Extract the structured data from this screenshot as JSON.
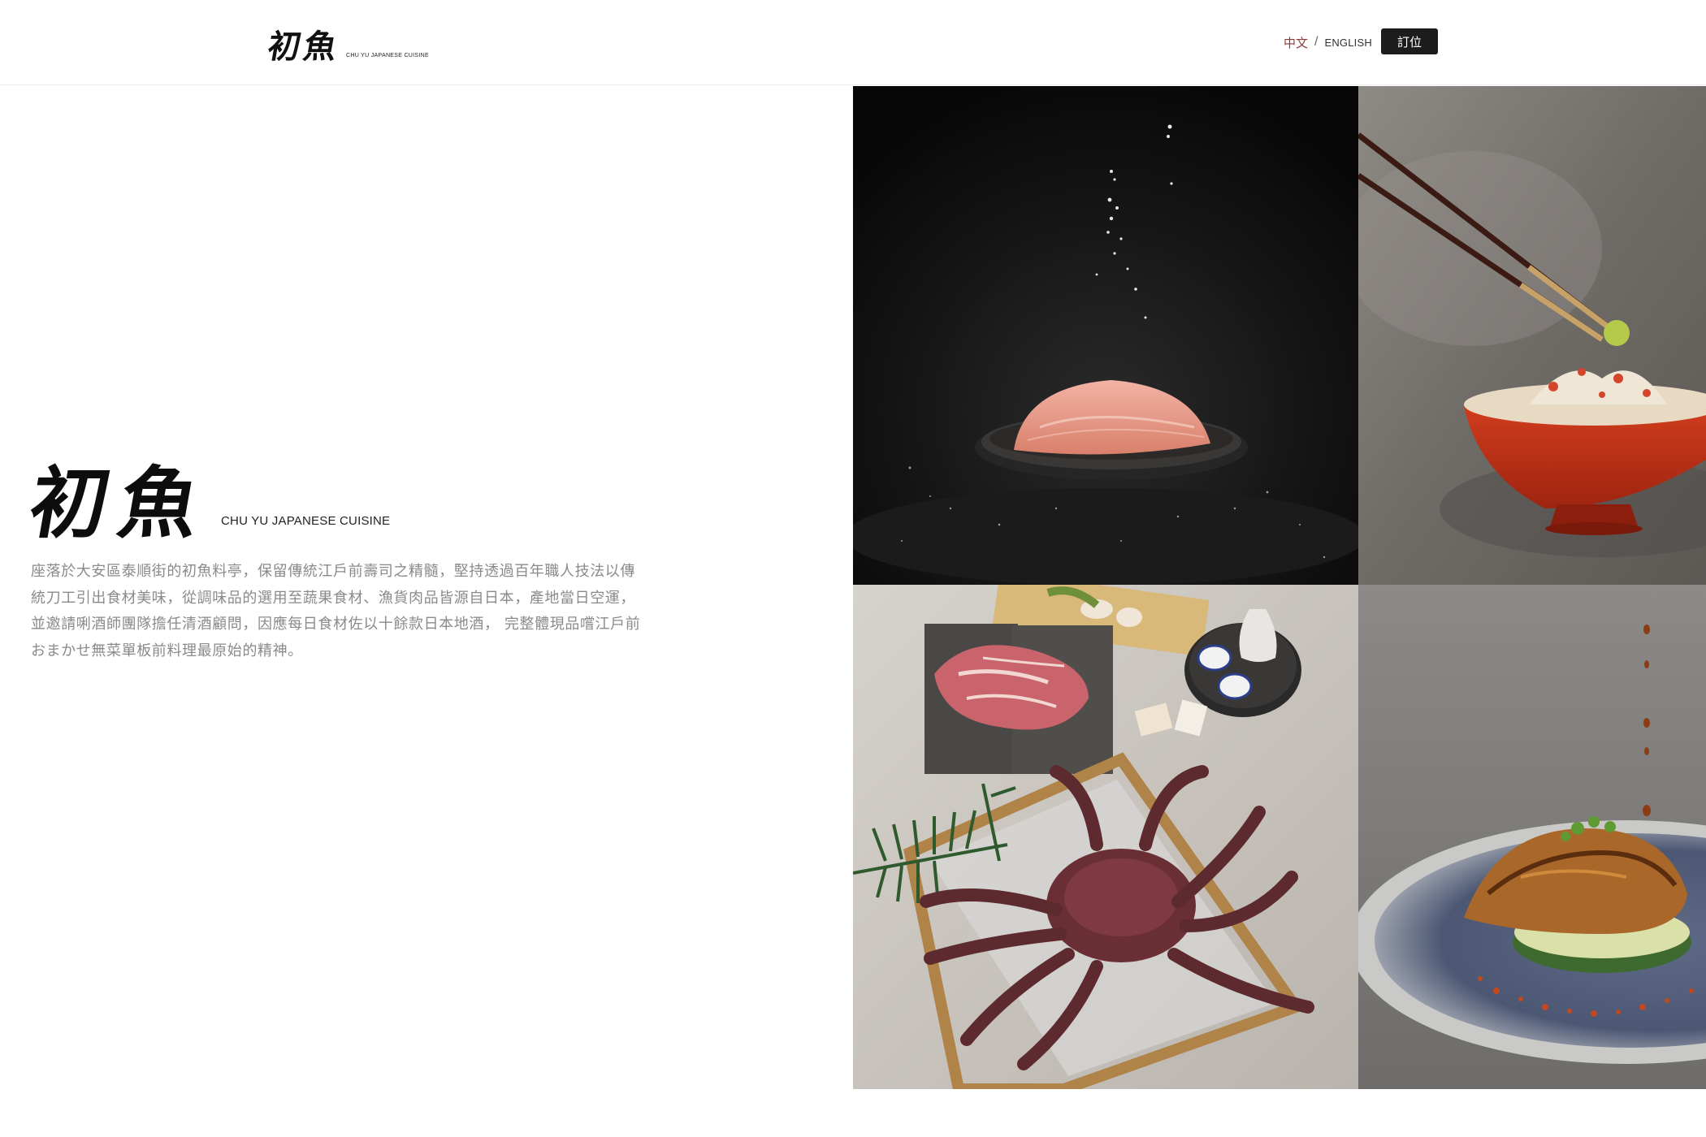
{
  "header": {
    "logo_kanji": "初魚",
    "logo_subtitle": "CHU YU JAPANESE CUISINE",
    "lang_zh": "中文",
    "lang_separator": "/",
    "lang_en": "ENGLISH",
    "reserve_label": "訂位"
  },
  "intro": {
    "logo_kanji": "初魚",
    "logo_subtitle": "CHU YU JAPANESE CUISINE",
    "description_lines": [
      "座落於大安區泰順街的初魚料亭，保留傳統江戶前壽司之精髓，堅持透過百年職人技法以傳",
      "統刀工引出食材美味，從調味品的選用至蔬果食材、漁貨肉品皆源自日本，產地當日空運，",
      "並邀請唎酒師團隊擔任清酒顧問，因應每日食材佐以十餘款日本地酒， 完整體現品嚐江戶前",
      "おまかせ無菜單板前料理最原始的精神。"
    ]
  },
  "colors": {
    "lang_active": "#8c3a3a",
    "reserve_bg": "#1c1c1c",
    "body_text": "#8a8a8a"
  }
}
